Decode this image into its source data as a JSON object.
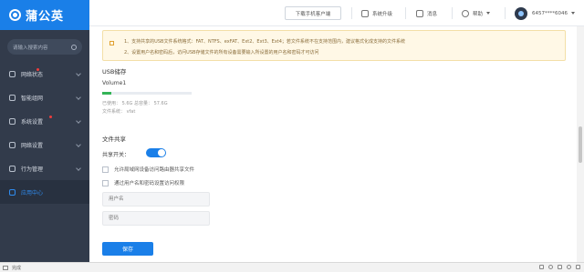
{
  "brand": {
    "name": "蒲公英"
  },
  "sidebar": {
    "search_placeholder": "请输入搜索内容",
    "items": [
      {
        "label": "网络状态",
        "dot": true
      },
      {
        "label": "智能组网",
        "dot": false
      },
      {
        "label": "系统设置",
        "dot": true
      },
      {
        "label": "网络设置",
        "dot": false
      },
      {
        "label": "行为管理",
        "dot": false
      },
      {
        "label": "应用中心",
        "dot": false,
        "active": true
      }
    ]
  },
  "topbar": {
    "download_client": "下载手机客户端",
    "upgrade": "系统升级",
    "messages": "消息",
    "help": "帮助",
    "user": "6457****6046"
  },
  "notice": {
    "line1": "1、支持共享的USB文件系统格式：FAT、NTFS、exFAT、Ext2、Ext3、Ext4；若文件系统不在支持范围内，建议格式化成支持的文件系统",
    "line2": "2、设置用户名和密码后，访问USB存储文件的所有设备需要输入所设置的用户名和密码才可访问"
  },
  "usb": {
    "title": "USB储存",
    "volume_name": "Volume1",
    "used_fraction": 0.1,
    "usage_text": "已使用： 5.6G    总容量： 57.6G",
    "filesystem_text": "文件系统： vfat"
  },
  "share": {
    "title": "文件共享",
    "toggle_label": "共享开关：",
    "toggle_on": true,
    "option_lan": "允许局域网设备访问路由器共享文件",
    "option_auth": "通过用户名和密码设置访问权限",
    "username_placeholder": "用户名",
    "password_placeholder": "密码",
    "save_label": "保存"
  },
  "statusbar": {
    "text": "完成"
  }
}
